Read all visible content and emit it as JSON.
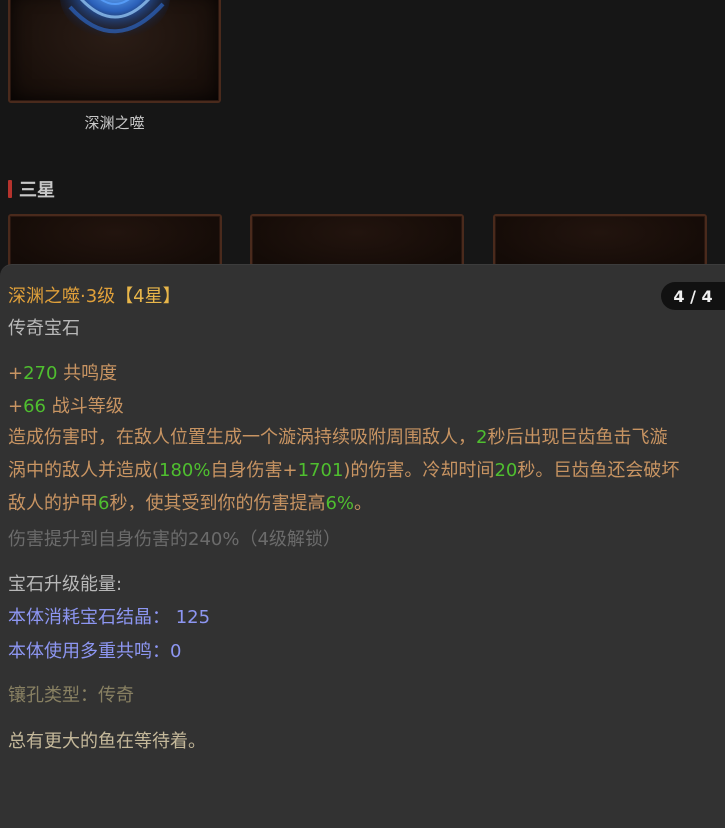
{
  "top_gem": {
    "name": "深渊之噬"
  },
  "section": {
    "title": "三星"
  },
  "tooltip": {
    "title_main": "深渊之噬·3级",
    "title_stars": "【4星】",
    "page_indicator": "4 / 4",
    "type": "传奇宝石",
    "attributes": [
      {
        "prefix": "+",
        "value": "270",
        "label": " 共鸣度"
      },
      {
        "prefix": "+",
        "value": "66",
        "label": " 战斗等级"
      }
    ],
    "description": {
      "l1a": "造成伤害时，在敌人位置生成一个漩涡持续吸附周围敌人，",
      "l1b": "2",
      "l1c": "秒后出现巨齿鱼击飞漩",
      "l2a": "涡中的敌人并造成(",
      "l2b": "180%",
      "l2c": "自身伤害+",
      "l2d": "1701",
      "l2e": ")的伤害。冷却时间",
      "l2f": "20",
      "l2g": "秒。巨齿鱼还会破坏",
      "l3a": "敌人的护甲",
      "l3b": "6",
      "l3c": "秒，使其受到你的伤害提高",
      "l3d": "6%",
      "l3e": "。"
    },
    "locked_bonus": "伤害提升到自身伤害的240%（4级解锁）",
    "energy_heading": "宝石升级能量:",
    "energy_crystal": "本体消耗宝石结晶： 125",
    "energy_resonance": "本体使用多重共鸣：0",
    "socket_type": "镶孔类型：传奇",
    "flavor_text": "总有更大的鱼在等待着。"
  },
  "colors": {
    "title": "#e0a03a",
    "positive": "#4fbf2f",
    "attribute": "#c89462",
    "energy": "#8d96f2",
    "section_bar": "#b5332d"
  },
  "icons": [
    "abyss-gem-art"
  ]
}
